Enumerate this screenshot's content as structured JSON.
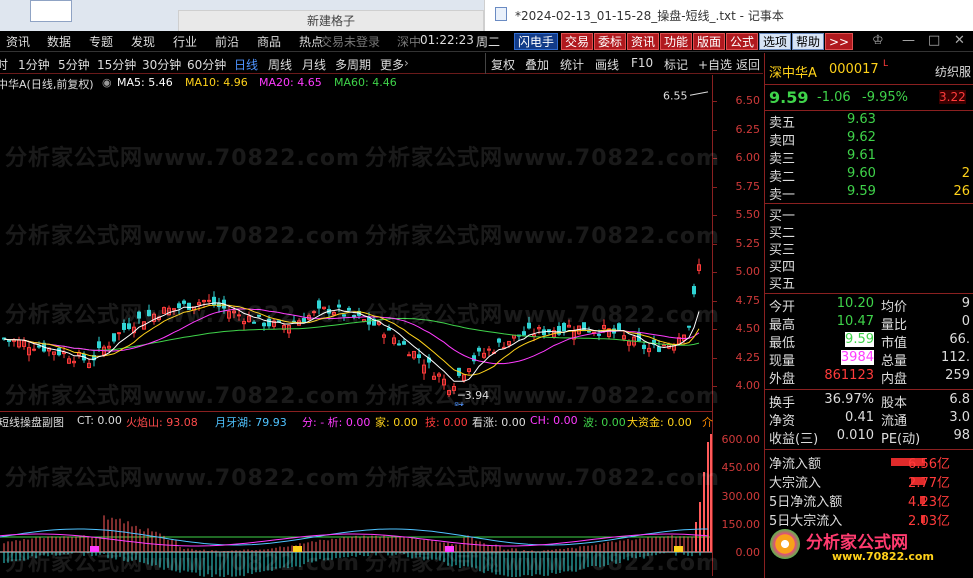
{
  "chrome": {
    "center_tab": "新建格子",
    "notepad_title": "*2024-02-13_01-15-28_操盘-短线_.txt - 记事本"
  },
  "menu": {
    "items": [
      "资讯",
      "数据",
      "专题",
      "发现",
      "行业",
      "前沿",
      "商品",
      "热点"
    ],
    "ghost_status": "交易未登录",
    "market": "深中",
    "time": "01:22:23",
    "weekday": "周二",
    "toolbar": [
      "闪电手",
      "交易",
      "委标",
      "资讯",
      "功能",
      "版面",
      "公式",
      "选项",
      "帮助",
      ">>"
    ]
  },
  "periods": {
    "items": [
      "时",
      "1分钟",
      "5分钟",
      "15分钟",
      "30分钟",
      "60分钟",
      "日线",
      "周线",
      "月线",
      "多周期",
      "更多"
    ],
    "active": "日线",
    "tools": [
      "复权",
      "叠加",
      "统计",
      "画线",
      "F10",
      "标记",
      "+自选",
      "返回"
    ]
  },
  "legend": {
    "stock": "中华A(日线,前复权)",
    "ma5": "MA5: 5.46",
    "ma10": "MA10: 4.96",
    "ma20": "MA20: 4.65",
    "ma60": "MA60: 4.46",
    "colors": {
      "ma5": "#ffffff",
      "ma10": "#ffd21a",
      "ma20": "#ff3bff",
      "ma60": "#3fd34a"
    }
  },
  "yaxis": {
    "ticks": [
      "6.50",
      "6.25",
      "6.00",
      "5.75",
      "5.50",
      "5.25",
      "5.00",
      "4.75",
      "4.50",
      "4.25",
      "4.00"
    ],
    "sub_ticks": [
      "600.00",
      "450.00",
      "300.00",
      "150.00",
      "0.00"
    ]
  },
  "annotations": {
    "high": "6.55",
    "low": "3.94",
    "low_tag": "财"
  },
  "sublegend": {
    "name": "短线操盘副图",
    "items": [
      {
        "text": "CT: 0.00",
        "color": "#dddddd"
      },
      {
        "text": "火焰山: 93.08",
        "color": "#ff4b4b"
      },
      {
        "text": "月牙湖: 79.93",
        "color": "#4fc3ff"
      },
      {
        "text": "分: - 析: 0.00",
        "color": "#ff3bff"
      },
      {
        "text": "家: 0.00",
        "color": "#ffd21a"
      },
      {
        "text": "技: 0.00",
        "color": "#ff3b3b"
      },
      {
        "text": "看涨: 0.00",
        "color": "#dddddd"
      },
      {
        "text": "CH: 0.00",
        "color": "#ff3bff"
      },
      {
        "text": "波: 0.00",
        "color": "#3fd34a"
      },
      {
        "text": "大资金: 0.00",
        "color": "#ffd21a"
      },
      {
        "text": "介",
        "color": "#ff8a00"
      }
    ]
  },
  "quote": {
    "name": "深中华A",
    "code": "000017",
    "flag": "L",
    "industry": "纺织服",
    "price": "9.59",
    "change": "-1.06",
    "pct": "-9.95%",
    "extra": "3.22",
    "asks": [
      {
        "label": "卖五",
        "price": "9.63",
        "vol": ""
      },
      {
        "label": "卖四",
        "price": "9.62",
        "vol": ""
      },
      {
        "label": "卖三",
        "price": "9.61",
        "vol": ""
      },
      {
        "label": "卖二",
        "price": "9.60",
        "vol": "2"
      },
      {
        "label": "卖一",
        "price": "9.59",
        "vol": "26"
      }
    ],
    "bids": [
      "买一",
      "买二",
      "买三",
      "买四",
      "买五"
    ],
    "stats": [
      {
        "l1": "今开",
        "v1": "10.20",
        "c1": "#3fd34a",
        "l2": "均价",
        "v2": "9"
      },
      {
        "l1": "最高",
        "v1": "10.47",
        "c1": "#3fd34a",
        "l2": "量比",
        "v2": "0"
      },
      {
        "l1": "最低",
        "v1": "9.59",
        "c1": "#3fd34a",
        "l2": "市值",
        "v2": "66."
      },
      {
        "l1": "现量",
        "v1": "3984",
        "c1": "#ff3bff",
        "l2": "总量",
        "v2": "112."
      },
      {
        "l1": "外盘",
        "v1": "861123",
        "c1": "#ff3b3b",
        "l2": "内盘",
        "v2": "259"
      }
    ],
    "stats2": [
      {
        "l1": "换手",
        "v1": "36.97%",
        "l2": "股本",
        "v2": "6.8"
      },
      {
        "l1": "净资",
        "v1": "0.41",
        "l2": "流通",
        "v2": "3.0"
      },
      {
        "l1": "收益(三)",
        "v1": "0.010",
        "l2": "PE(动)",
        "v2": "98"
      }
    ],
    "flows": [
      {
        "label": "净流入额",
        "value": "6.56亿",
        "fill": 0.85
      },
      {
        "label": "大宗流入",
        "value": "2.77亿",
        "fill": 0.36
      },
      {
        "label": "5日净流入额",
        "value": "4.23亿",
        "fill": 0.12
      },
      {
        "label": "5日大宗流入",
        "value": "2.03亿",
        "fill": 0.1
      }
    ]
  },
  "watermark": "分析家公式网www.70822.com",
  "logo": {
    "title": "分析家公式网",
    "url": "www.70822.com"
  }
}
